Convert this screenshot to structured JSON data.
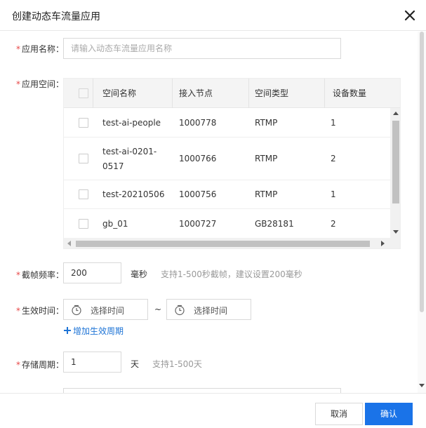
{
  "dialog": {
    "title": "创建动态车流量应用",
    "close_icon": "close-icon"
  },
  "form": {
    "app_name": {
      "label": "应用名称：",
      "placeholder": "请输入动态车流量应用名称",
      "value": ""
    },
    "app_space": {
      "label": "应用空间：",
      "columns": [
        "空间名称",
        "接入节点",
        "空间类型",
        "设备数量"
      ],
      "rows": [
        {
          "name": "test-ai-people",
          "node": "1000778",
          "type": "RTMP",
          "count": "1"
        },
        {
          "name": "test-ai-0201-",
          "name2": "0517",
          "node": "1000766",
          "type": "RTMP",
          "count": "2"
        },
        {
          "name": "test-20210506",
          "node": "1000756",
          "type": "RTMP",
          "count": "1"
        },
        {
          "name": "gb_01",
          "node": "1000727",
          "type": "GB28181",
          "count": "2"
        }
      ]
    },
    "frame_rate": {
      "label": "截帧频率：",
      "value": "200",
      "unit": "毫秒",
      "hint": "支持1-500秒截帧，建议设置200毫秒"
    },
    "effective_time": {
      "label": "生效时间：",
      "start_placeholder": "选择时间",
      "separator": "~",
      "end_placeholder": "选择时间",
      "add_link": "增加生效周期"
    },
    "storage": {
      "label": "存储周期：",
      "value": "1",
      "unit": "天",
      "hint": "支持1-500天"
    }
  },
  "footer": {
    "cancel": "取消",
    "ok": "确认"
  },
  "colors": {
    "primary": "#1a73e8",
    "required": "#e84848"
  }
}
